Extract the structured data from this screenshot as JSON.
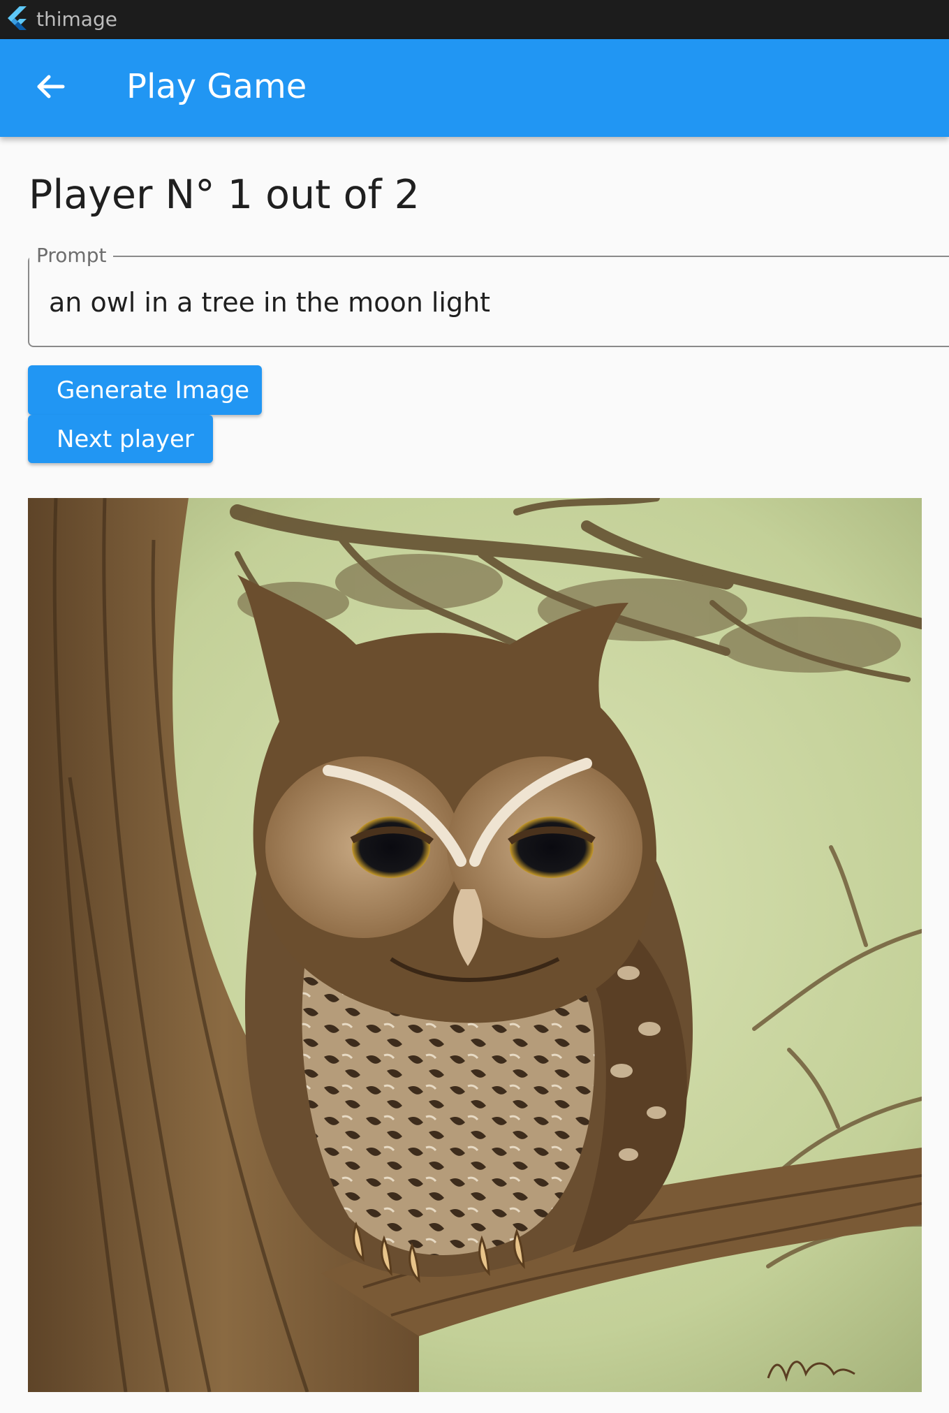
{
  "window": {
    "title": "thimage",
    "icon": "flutter-logo-icon"
  },
  "appbar": {
    "title": "Play Game",
    "back_icon": "arrow-back-icon",
    "color": "#2196f3"
  },
  "main": {
    "player_heading": "Player N° 1 out of 2",
    "prompt": {
      "label": "Prompt",
      "value": "an owl in a tree in the moon light"
    },
    "buttons": {
      "generate_label": "Generate Image",
      "next_label": "Next player"
    },
    "image": {
      "alt": "an owl in a tree in the moon light"
    }
  }
}
